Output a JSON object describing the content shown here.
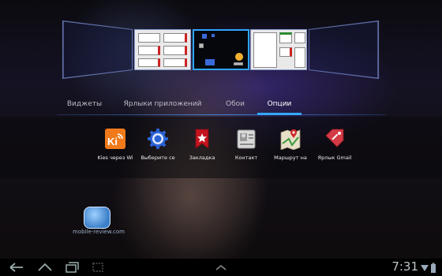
{
  "tabs": [
    {
      "label": "Виджеты",
      "active": false
    },
    {
      "label": "Ярлыки приложений",
      "active": false
    },
    {
      "label": "Обои",
      "active": false
    },
    {
      "label": "Опции",
      "active": true
    }
  ],
  "options": [
    {
      "label": "Kies через Wi",
      "icon": "kies-wifi-icon"
    },
    {
      "label": "Выберите се",
      "icon": "settings-gear-icon"
    },
    {
      "label": "Закладка",
      "icon": "bookmark-icon"
    },
    {
      "label": "Контакт",
      "icon": "contact-icon"
    },
    {
      "label": "Маршрут на",
      "icon": "map-route-icon"
    },
    {
      "label": "Ярлык Gmail",
      "icon": "gmail-label-icon"
    }
  ],
  "kies_badge": "Ki",
  "widget": {
    "text": "mobile-review.com"
  },
  "status": {
    "time": "7:31"
  },
  "colors": {
    "accent": "#33a8ff",
    "bookmark": "#c4141e",
    "gmail": "#d33a45",
    "kies": "#f07a1a"
  }
}
